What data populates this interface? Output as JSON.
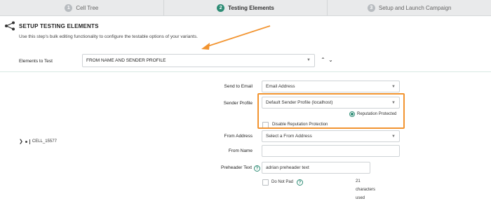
{
  "stepper": {
    "steps": [
      {
        "num": "1",
        "label": "Cell Tree"
      },
      {
        "num": "2",
        "label": "Testing Elements"
      },
      {
        "num": "3",
        "label": "Setup and Launch Campaign"
      }
    ],
    "active_index": 1
  },
  "section": {
    "title": "SETUP TESTING ELEMENTS",
    "subtitle": "Use this step's bulk editing functionality to configure the testable options of your variants."
  },
  "elements_to_test": {
    "label": "Elements to Test",
    "value": "FROM NAME AND SENDER PROFILE"
  },
  "cell": {
    "label": "CELL_15577"
  },
  "form": {
    "send_to_email": {
      "label": "Send to Email",
      "value": "Email Address"
    },
    "sender_profile": {
      "label": "Sender Profile",
      "value": "Default Sender Profile (localhost)"
    },
    "reputation": {
      "label": "Reputation Protected"
    },
    "disable_reputation": {
      "label": "Disable Reputation Protection"
    },
    "from_address": {
      "label": "From Address",
      "placeholder": "Select a From Address"
    },
    "from_name": {
      "label": "From Name",
      "value": ""
    },
    "preheader_text": {
      "label": "Preheader Text",
      "value": "adrian preheader text"
    },
    "do_not_pad": {
      "label": "Do Not Pad"
    },
    "char_count": {
      "count": "21",
      "line1": "characters",
      "line2": "used"
    }
  },
  "colors": {
    "accent": "#2e8c75",
    "highlight": "#f29430"
  }
}
